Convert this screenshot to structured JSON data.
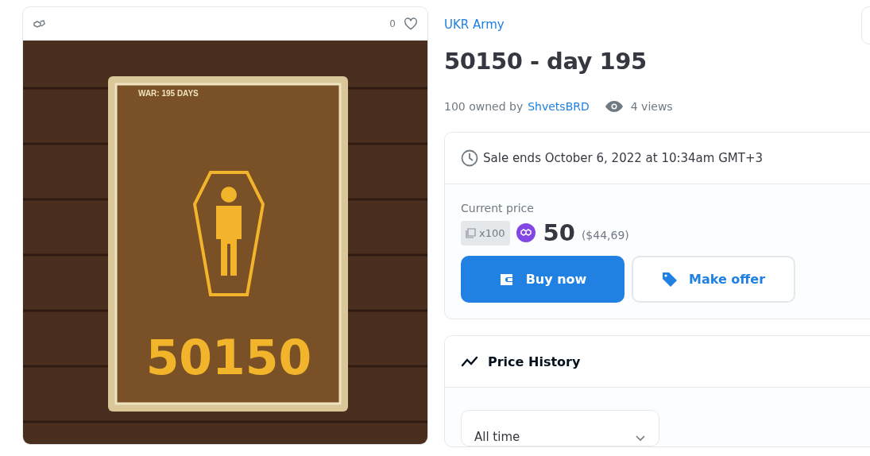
{
  "item_card": {
    "likes": "0",
    "liked": false,
    "artwork": {
      "caption": "WAR: 195 DAYS",
      "number": "50150"
    }
  },
  "collection": "UKR Army",
  "title": "50150 - day 195",
  "ownership": {
    "owned_text": "100 owned by",
    "owner": "ShvetsBRD",
    "views": "4 views"
  },
  "sale": {
    "ends": "Sale ends October 6, 2022 at 10:34am GMT+3",
    "price_label": "Current price",
    "quantity": "x100",
    "price": "50",
    "fiat": "($44,69)",
    "buttons": [
      {
        "kind": "primary",
        "label": "Buy now"
      },
      {
        "kind": "secondary",
        "label": "Make offer"
      }
    ]
  },
  "price_history": {
    "title": "Price History",
    "period": "All time"
  }
}
